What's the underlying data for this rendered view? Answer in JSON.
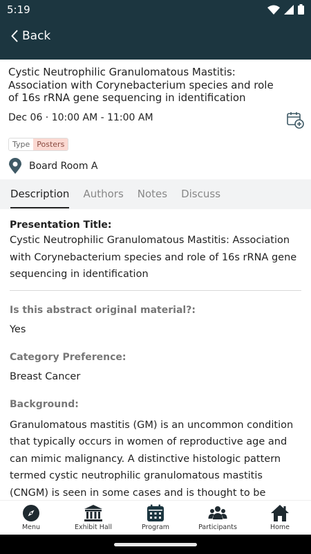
{
  "status_bar": {
    "time": "5:19"
  },
  "app_bar": {
    "back_label": "Back"
  },
  "session": {
    "title": "Cystic Neutrophilic Granulomatous Mastitis: Association with Corynebacterium species and role of 16s rRNA gene sequencing in identification",
    "datetime": "Dec 06 · 10:00 AM - 11:00 AM",
    "type_key": "Type",
    "type_value": "Posters",
    "location": "Board Room A"
  },
  "tabs": [
    {
      "label": "Description",
      "active": true
    },
    {
      "label": "Authors",
      "active": false
    },
    {
      "label": "Notes",
      "active": false
    },
    {
      "label": "Discuss",
      "active": false
    }
  ],
  "description": {
    "presentation_title_label": "Presentation Title:",
    "presentation_title": "Cystic Neutrophilic Granulomatous Mastitis: Association with Corynebacterium species and role of 16s rRNA gene sequencing in identification",
    "original_label": "Is this abstract original material?:",
    "original_value": "Yes",
    "category_label": "Category Preference:",
    "category_value": "Breast Cancer",
    "background_label": "Background:",
    "background_text": "Granulomatous mastitis (GM) is an uncommon condition that typically occurs in women of reproductive age and can mimic malignancy. A distinctive histologic pattern termed cystic neutrophilic granulomatous mastitis (CNGM) is seen in some cases and is thought to be associated with"
  },
  "bottom_nav": [
    {
      "label": "Menu",
      "icon": "compass-icon"
    },
    {
      "label": "Exhibit Hall",
      "icon": "building-icon"
    },
    {
      "label": "Program",
      "icon": "calendar-icon"
    },
    {
      "label": "Participants",
      "icon": "people-icon"
    },
    {
      "label": "Home",
      "icon": "home-icon"
    }
  ],
  "colors": {
    "header_bg": "#1c3640",
    "program_accent": "#1c3640",
    "tag_bg": "#fbd9d2",
    "pin": "#3f5a66"
  }
}
